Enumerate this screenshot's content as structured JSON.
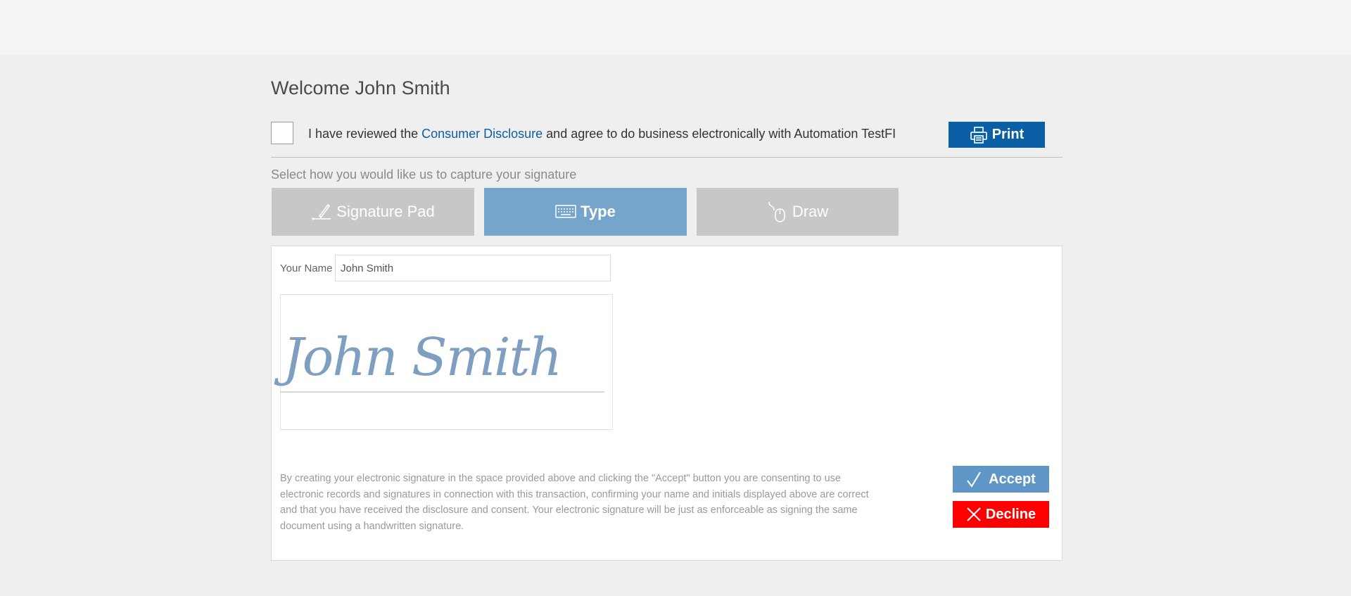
{
  "welcome": {
    "title": "Welcome John Smith"
  },
  "agreement": {
    "text_before": "I have reviewed the ",
    "link_label": "Consumer Disclosure",
    "text_after": " and agree to do business electronically with Automation TestFI",
    "checked": false
  },
  "print": {
    "label": "Print",
    "icon": "printer-icon"
  },
  "capture": {
    "prompt": "Select how you would like us to capture your signature",
    "tabs": [
      {
        "label": "Signature Pad",
        "icon": "pen-icon",
        "active": false
      },
      {
        "label": "Type",
        "icon": "keyboard-icon",
        "active": true
      },
      {
        "label": "Draw",
        "icon": "mouse-icon",
        "active": false
      }
    ]
  },
  "form": {
    "name_label": "Your Name",
    "name_value": "John Smith",
    "signature_preview": "John Smith"
  },
  "legal_text": "By creating your electronic signature in the space provided above and clicking the \"Accept\" button you are consenting to use electronic records and signatures in connection with this transaction, confirming your name and initials displayed above are correct and that you have received the disclosure and consent. Your electronic signature will be just as enforceable as signing the same document using a handwritten signature.",
  "actions": {
    "accept_label": "Accept",
    "decline_label": "Decline"
  },
  "colors": {
    "primary": "#0b5fa5",
    "tab_active": "#76a5cb",
    "tab_inactive": "#c8c7c8",
    "accept": "#5e96c6",
    "decline": "#ff0000",
    "signature": "#7e9fc0"
  }
}
